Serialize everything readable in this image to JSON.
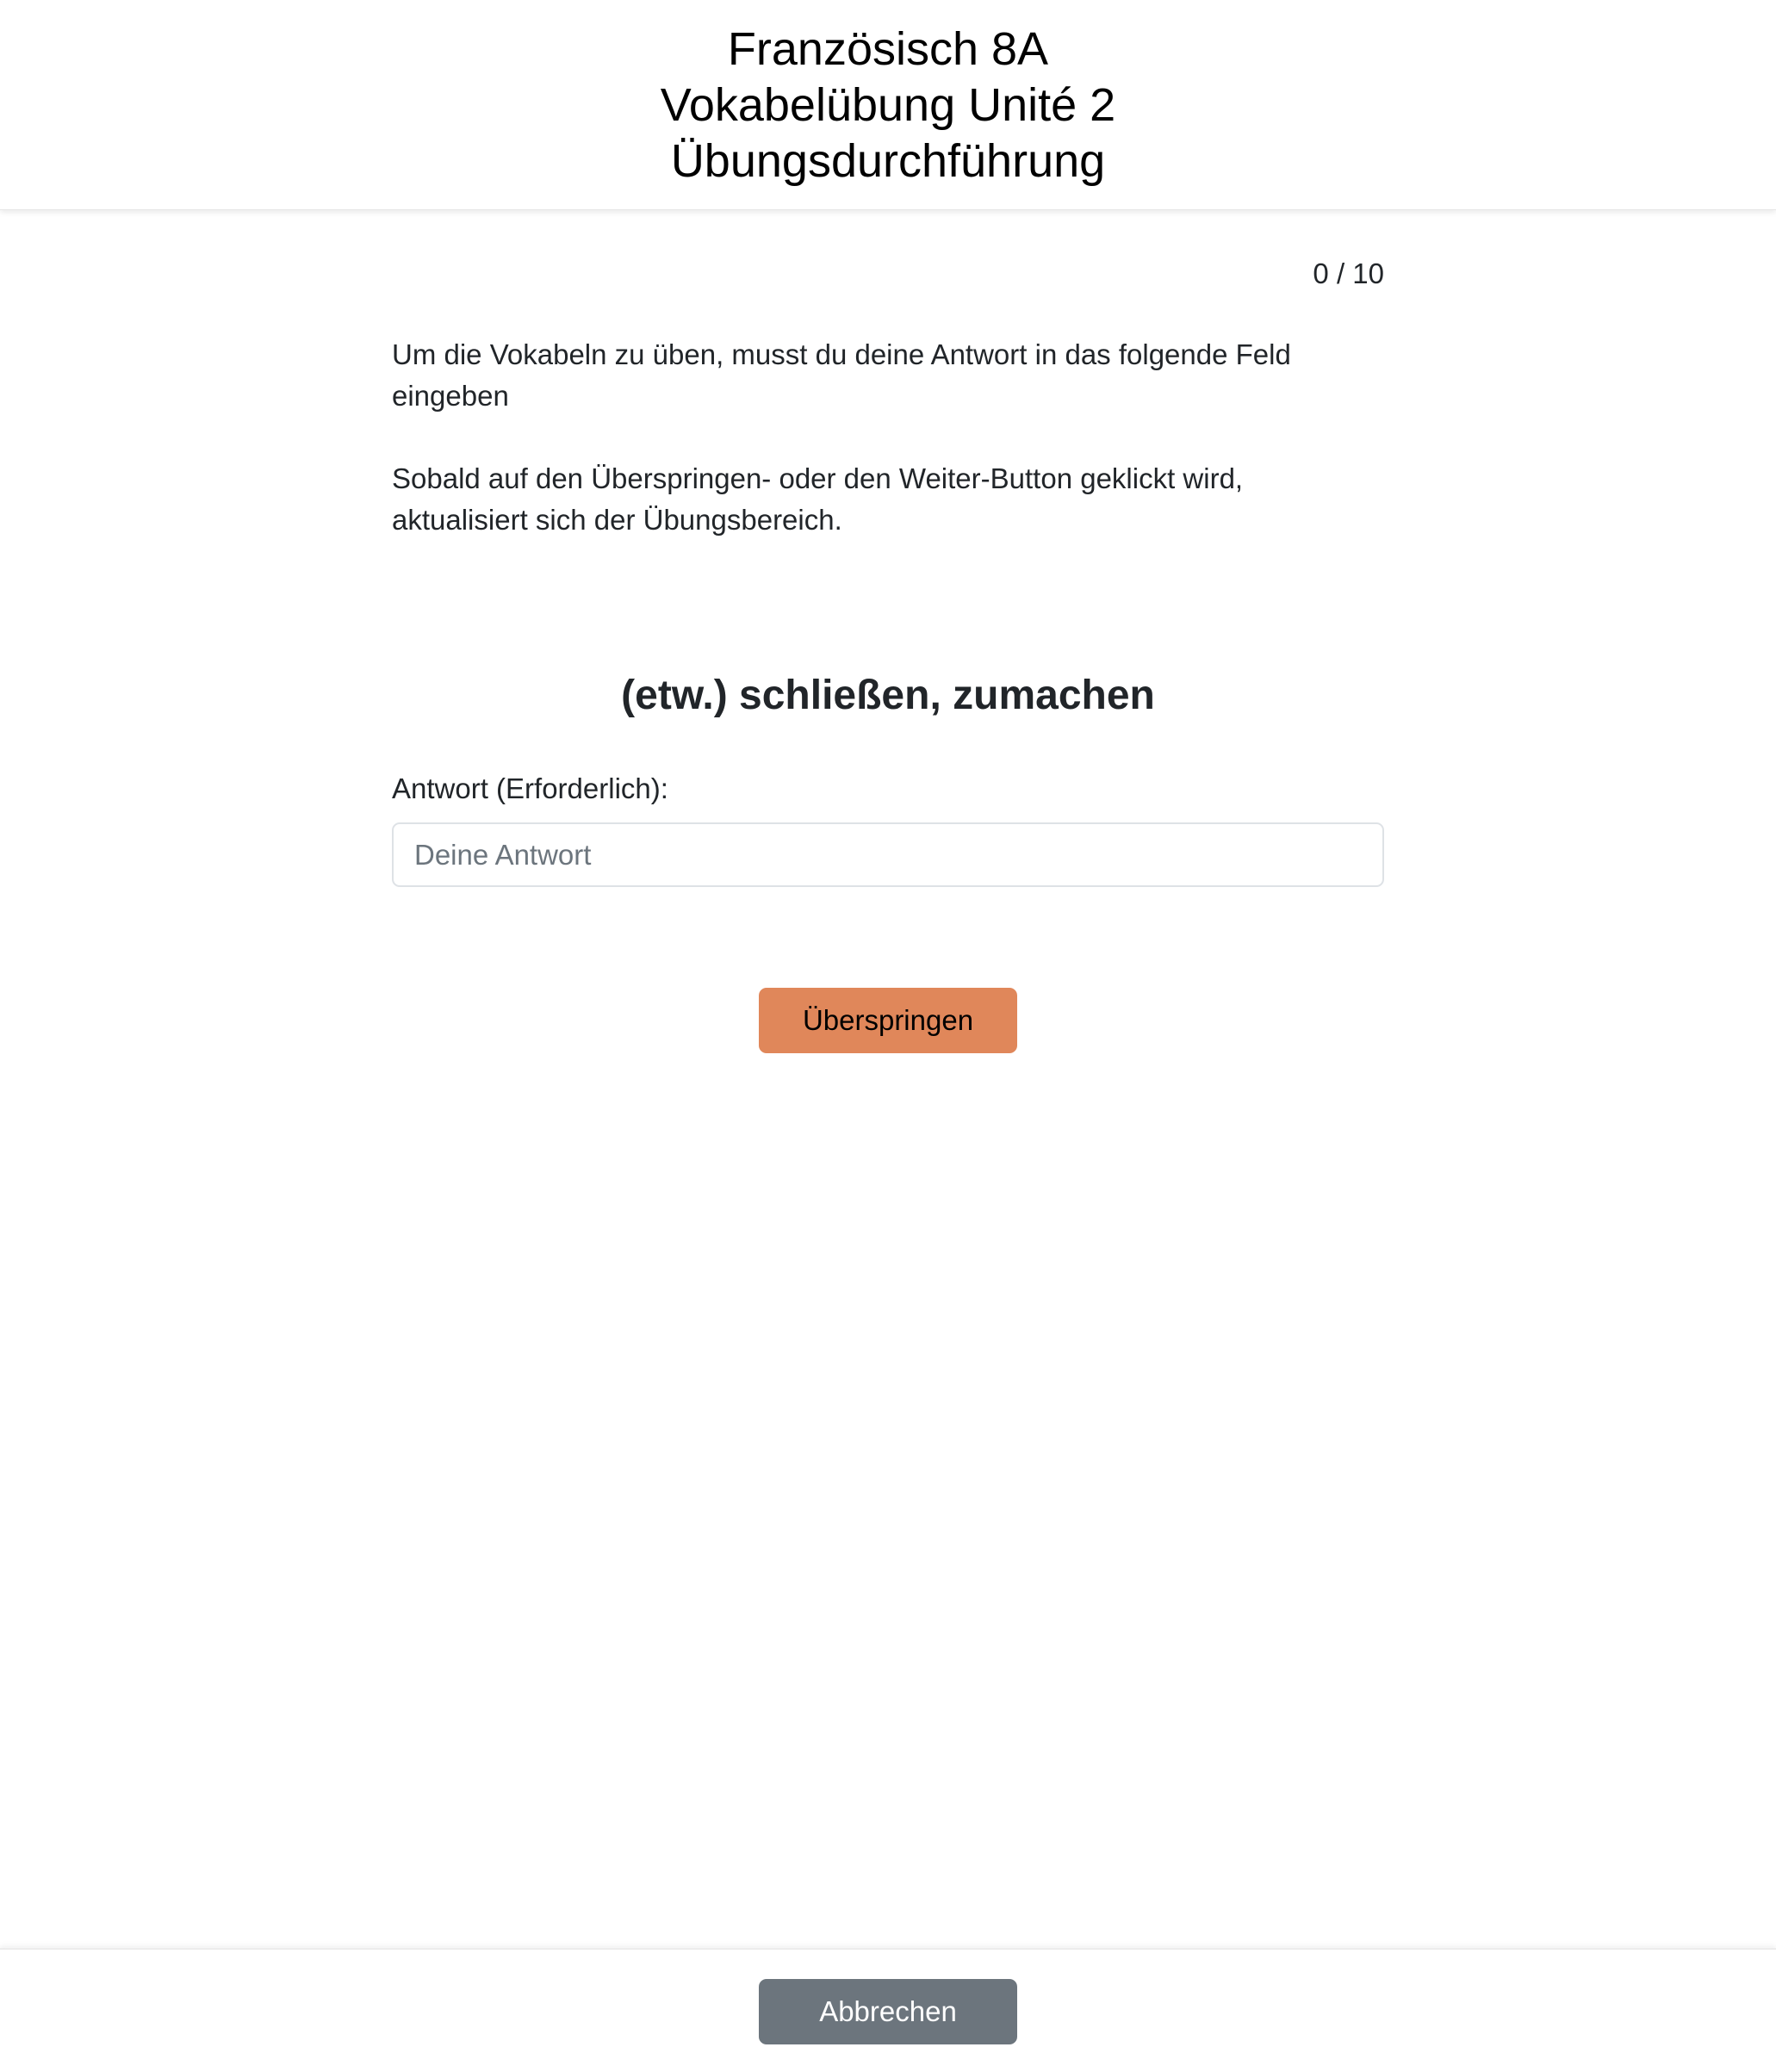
{
  "header": {
    "course": "Französisch 8A",
    "exercise": "Vokabelübung Unité 2",
    "mode": "Übungsdurchführung"
  },
  "progress": {
    "text": "0 / 10",
    "done": 0,
    "total": 10
  },
  "instructions": {
    "paragraph1": "Um die Vokabeln zu üben, musst du deine Antwort in das folgende Feld eingeben",
    "paragraph2": "Sobald auf den Überspringen- oder den Weiter-Button geklickt wird, aktualisiert sich der Übungsbereich."
  },
  "vocab": {
    "prompt": "(etw.) schließen, zumachen"
  },
  "answer": {
    "label": "Antwort (Erforderlich):",
    "placeholder": "Deine Antwort",
    "value": ""
  },
  "actions": {
    "skip_label": "Überspringen",
    "cancel_label": "Abbrechen"
  },
  "colors": {
    "skip_button": "#e0875a",
    "cancel_button": "#6c757d"
  }
}
